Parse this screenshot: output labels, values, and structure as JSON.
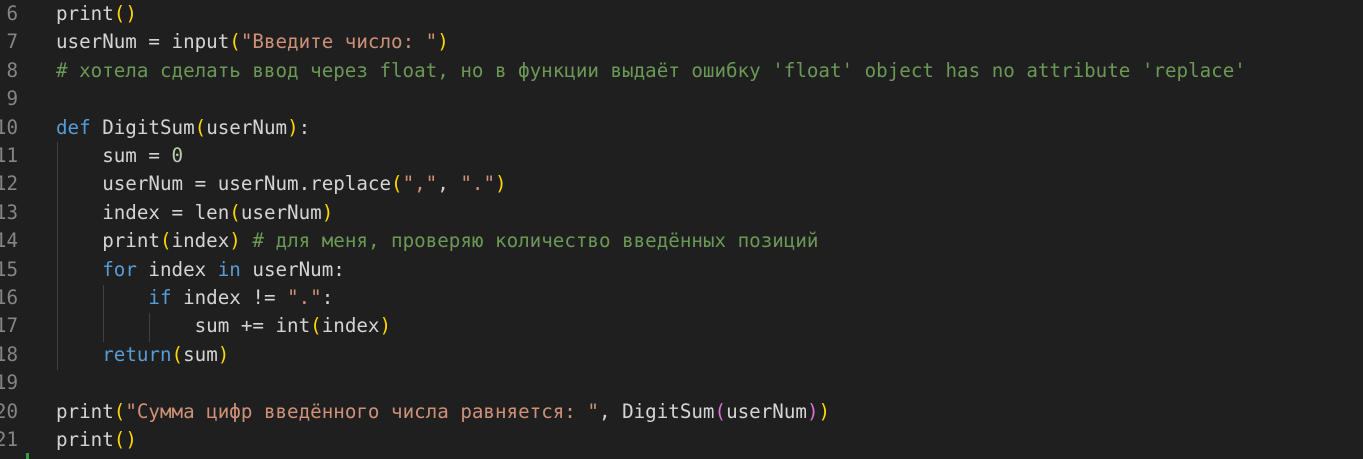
{
  "editor": {
    "language": "python",
    "colors": {
      "background": "#1f1f1f",
      "keyword": "#569cd6",
      "string": "#ce9178",
      "comment": "#6a9955",
      "number": "#b5cea8",
      "bracket1": "#ffd700",
      "bracket2": "#da70d6"
    },
    "lines": [
      {
        "num": "6",
        "tokens": [
          [
            "print",
            "tx"
          ],
          [
            "(",
            "p1"
          ],
          [
            ")",
            "p1"
          ]
        ]
      },
      {
        "num": "7",
        "tokens": [
          [
            "userNum = input",
            "tx"
          ],
          [
            "(",
            "p1"
          ],
          [
            "\"Введите число: \"",
            "str"
          ],
          [
            ")",
            "p1"
          ]
        ]
      },
      {
        "num": "8",
        "tokens": [
          [
            "# хотела сделать ввод через float, но в функции выдаёт ошибку 'float' object has no attribute 'replace'",
            "cm"
          ]
        ]
      },
      {
        "num": "9",
        "tokens": []
      },
      {
        "num": "10",
        "tokens": [
          [
            "def",
            "kw"
          ],
          [
            " DigitSum",
            "tx"
          ],
          [
            "(",
            "p1"
          ],
          [
            "userNum",
            "tx"
          ],
          [
            ")",
            "p1"
          ],
          [
            ":",
            "tx"
          ]
        ]
      },
      {
        "num": "11",
        "tokens": [
          [
            "    sum = ",
            "tx"
          ],
          [
            "0",
            "num"
          ]
        ]
      },
      {
        "num": "12",
        "tokens": [
          [
            "    userNum = userNum.replace",
            "tx"
          ],
          [
            "(",
            "p1"
          ],
          [
            "\",\"",
            "str"
          ],
          [
            ", ",
            "tx"
          ],
          [
            "\".\"",
            "str"
          ],
          [
            ")",
            "p1"
          ]
        ]
      },
      {
        "num": "13",
        "tokens": [
          [
            "    index = len",
            "tx"
          ],
          [
            "(",
            "p1"
          ],
          [
            "userNum",
            "tx"
          ],
          [
            ")",
            "p1"
          ]
        ]
      },
      {
        "num": "14",
        "tokens": [
          [
            "    print",
            "tx"
          ],
          [
            "(",
            "p1"
          ],
          [
            "index",
            "tx"
          ],
          [
            ")",
            "p1"
          ],
          [
            " ",
            "tx"
          ],
          [
            "# для меня, проверяю количество введённых позиций",
            "cm"
          ]
        ]
      },
      {
        "num": "15",
        "tokens": [
          [
            "    ",
            "tx"
          ],
          [
            "for",
            "kw"
          ],
          [
            " index ",
            "tx"
          ],
          [
            "in",
            "kw"
          ],
          [
            " userNum:",
            "tx"
          ]
        ]
      },
      {
        "num": "16",
        "tokens": [
          [
            "        ",
            "tx"
          ],
          [
            "if",
            "kw"
          ],
          [
            " index != ",
            "tx"
          ],
          [
            "\".\"",
            "str"
          ],
          [
            ":",
            "tx"
          ]
        ]
      },
      {
        "num": "17",
        "tokens": [
          [
            "            sum += int",
            "tx"
          ],
          [
            "(",
            "p1"
          ],
          [
            "index",
            "tx"
          ],
          [
            ")",
            "p1"
          ]
        ]
      },
      {
        "num": "18",
        "tokens": [
          [
            "    ",
            "tx"
          ],
          [
            "return",
            "kw"
          ],
          [
            "(",
            "p1"
          ],
          [
            "sum",
            "tx"
          ],
          [
            ")",
            "p1"
          ]
        ]
      },
      {
        "num": "19",
        "tokens": []
      },
      {
        "num": "20",
        "tokens": [
          [
            "print",
            "tx"
          ],
          [
            "(",
            "p1"
          ],
          [
            "\"Сумма цифр введённого числа равняется: \"",
            "str"
          ],
          [
            ", DigitSum",
            "tx"
          ],
          [
            "(",
            "p2"
          ],
          [
            "userNum",
            "tx"
          ],
          [
            ")",
            "p2"
          ],
          [
            ")",
            "p1"
          ]
        ]
      },
      {
        "num": "21",
        "tokens": [
          [
            "print",
            "tx"
          ],
          [
            "(",
            "p1"
          ],
          [
            ")",
            "p1"
          ]
        ]
      }
    ]
  }
}
